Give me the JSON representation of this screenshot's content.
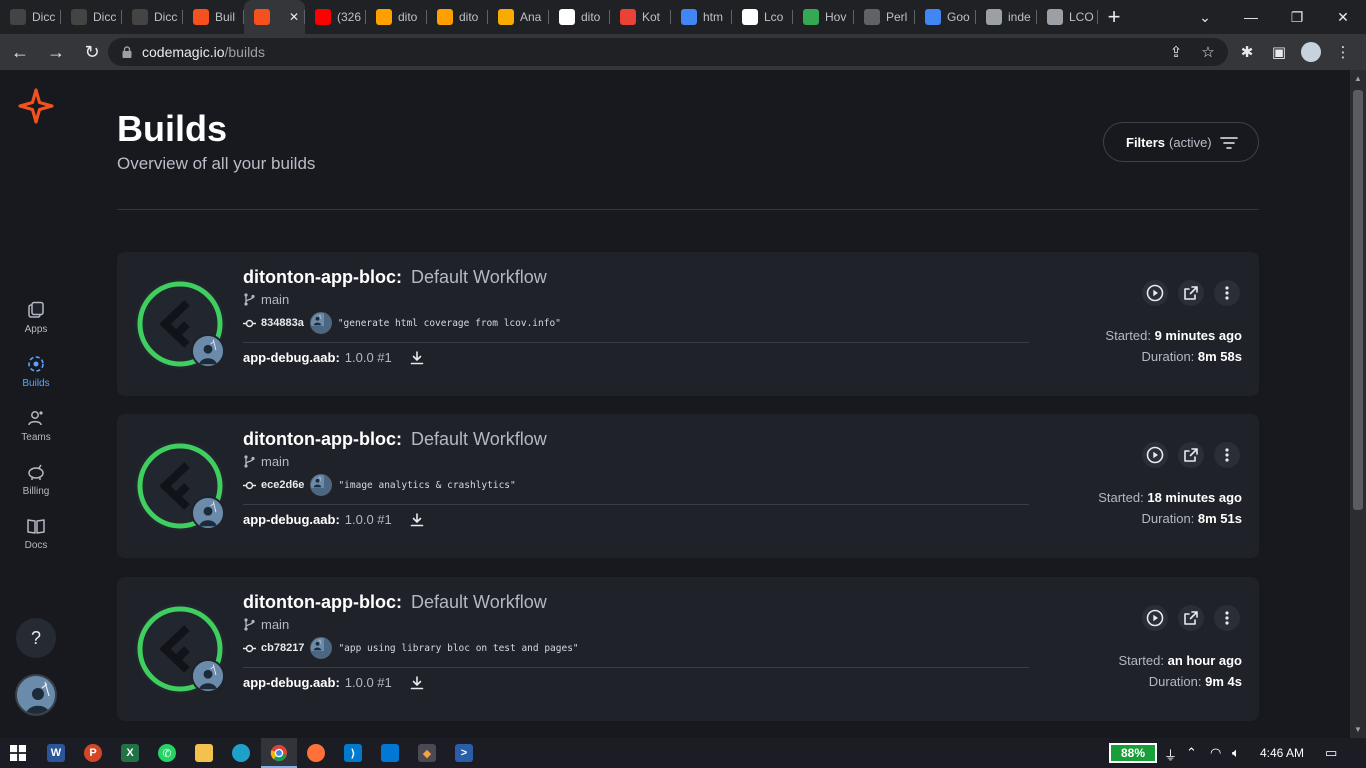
{
  "browser": {
    "tabs": [
      {
        "label": "Dicc",
        "icon": "g-letter-icon",
        "color": "#444"
      },
      {
        "label": "Dicc",
        "icon": "g-letter-icon",
        "color": "#444"
      },
      {
        "label": "Dicc",
        "icon": "g-letter-icon",
        "color": "#444"
      },
      {
        "label": "Buil",
        "icon": "codemagic-icon",
        "color": "#f4511e"
      },
      {
        "label": "",
        "icon": "codemagic-icon",
        "color": "#f4511e",
        "active": true
      },
      {
        "label": "(326",
        "icon": "youtube-icon",
        "color": "#ff0000"
      },
      {
        "label": "dito",
        "icon": "firebase-icon",
        "color": "#ffa000"
      },
      {
        "label": "dito",
        "icon": "firebase-icon",
        "color": "#ffa000"
      },
      {
        "label": "Ana",
        "icon": "analytics-icon",
        "color": "#f9ab00"
      },
      {
        "label": "dito",
        "icon": "github-icon",
        "color": "#ffffff"
      },
      {
        "label": "Kot",
        "icon": "gmail-icon",
        "color": "#ea4335"
      },
      {
        "label": "htm",
        "icon": "google-icon",
        "color": "#4285f4"
      },
      {
        "label": "Lco",
        "icon": "medium-icon",
        "color": "#ffffff"
      },
      {
        "label": "Hov",
        "icon": "greenshot-icon",
        "color": "#34a853"
      },
      {
        "label": "Perl",
        "icon": "as-icon",
        "color": "#5f6368"
      },
      {
        "label": "Goo",
        "icon": "translate-icon",
        "color": "#4285f4"
      },
      {
        "label": "inde",
        "icon": "globe-icon",
        "color": "#9aa0a6"
      },
      {
        "label": "LCO",
        "icon": "globe-icon",
        "color": "#9aa0a6"
      }
    ],
    "url_host": "codemagic.io",
    "url_path": "/builds"
  },
  "sidebar": {
    "items": [
      {
        "label": "Apps",
        "icon": "apps-icon"
      },
      {
        "label": "Builds",
        "icon": "builds-icon",
        "active": true
      },
      {
        "label": "Teams",
        "icon": "teams-icon"
      },
      {
        "label": "Billing",
        "icon": "billing-icon"
      },
      {
        "label": "Docs",
        "icon": "docs-icon"
      }
    ],
    "help_label": "?"
  },
  "header": {
    "title": "Builds",
    "subtitle": "Overview of all your builds",
    "filters_label": "Filters",
    "filters_state": "(active)"
  },
  "builds": [
    {
      "app": "ditonton-app-bloc:",
      "workflow": "Default Workflow",
      "branch": "main",
      "commit_hash": "834883a",
      "commit_message": "\"generate html coverage from lcov.info\"",
      "artifact_name": "app-debug.aab:",
      "artifact_version": "1.0.0 #1",
      "started_label": "Started:",
      "started_value": "9 minutes ago",
      "duration_label": "Duration:",
      "duration_value": "8m 58s"
    },
    {
      "app": "ditonton-app-bloc:",
      "workflow": "Default Workflow",
      "branch": "main",
      "commit_hash": "ece2d6e",
      "commit_message": "\"image analytics & crashlytics\"",
      "artifact_name": "app-debug.aab:",
      "artifact_version": "1.0.0 #1",
      "started_label": "Started:",
      "started_value": "18 minutes ago",
      "duration_label": "Duration:",
      "duration_value": "8m 51s"
    },
    {
      "app": "ditonton-app-bloc:",
      "workflow": "Default Workflow",
      "branch": "main",
      "commit_hash": "cb78217",
      "commit_message": "\"app using library bloc on test and pages\"",
      "artifact_name": "app-debug.aab:",
      "artifact_version": "1.0.0 #1",
      "started_label": "Started:",
      "started_value": "an hour ago",
      "duration_label": "Duration:",
      "duration_value": "9m 4s"
    }
  ],
  "taskbar": {
    "battery": "88%",
    "time": "4:46 AM"
  },
  "colors": {
    "accent": "#5ba3ff",
    "success_ring": "#3ecf5e",
    "brand": "#f4511e"
  }
}
